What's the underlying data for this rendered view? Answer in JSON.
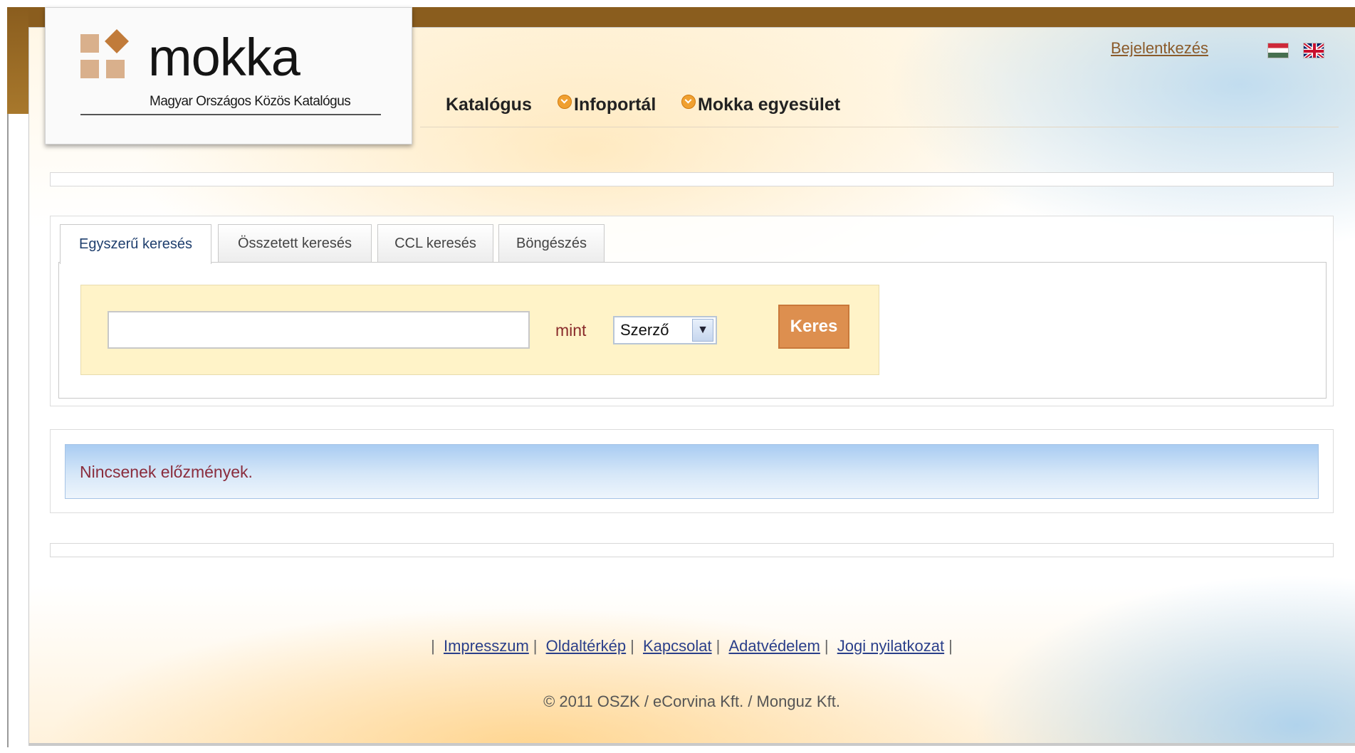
{
  "logo": {
    "wordmark": "mokka",
    "subtitle": "Magyar Országos Közös Katalógus"
  },
  "header": {
    "login_label": "Bejelentkezés",
    "languages": [
      "hu-flag-icon",
      "uk-flag-icon"
    ]
  },
  "nav": {
    "items": [
      {
        "label": "Katalógus",
        "bullet": false
      },
      {
        "label": "Infoportál",
        "bullet": true
      },
      {
        "label": "Mokka egyesület",
        "bullet": true
      }
    ]
  },
  "search": {
    "tabs": [
      {
        "label": "Egyszerű keresés",
        "active": true
      },
      {
        "label": "Összetett keresés",
        "active": false
      },
      {
        "label": "CCL keresés",
        "active": false
      },
      {
        "label": "Böngészés",
        "active": false
      }
    ],
    "input_value": "",
    "as_label": "mint",
    "field_select_value": "Szerző",
    "submit_label": "Keres"
  },
  "history": {
    "empty_text": "Nincsenek előzmények."
  },
  "footer": {
    "links": [
      "Impresszum",
      "Oldaltérkép",
      "Kapcsolat",
      "Adatvédelem",
      "Jogi nyilatkozat"
    ],
    "copyright": "© 2011 OSZK / eCorvina Kft. / Monguz Kft."
  },
  "colors": {
    "brand_brown": "#8a5d1e",
    "search_button": "#dd8f4f",
    "history_blue": "#a9ccf2",
    "search_box_bg": "#fff3c8"
  }
}
